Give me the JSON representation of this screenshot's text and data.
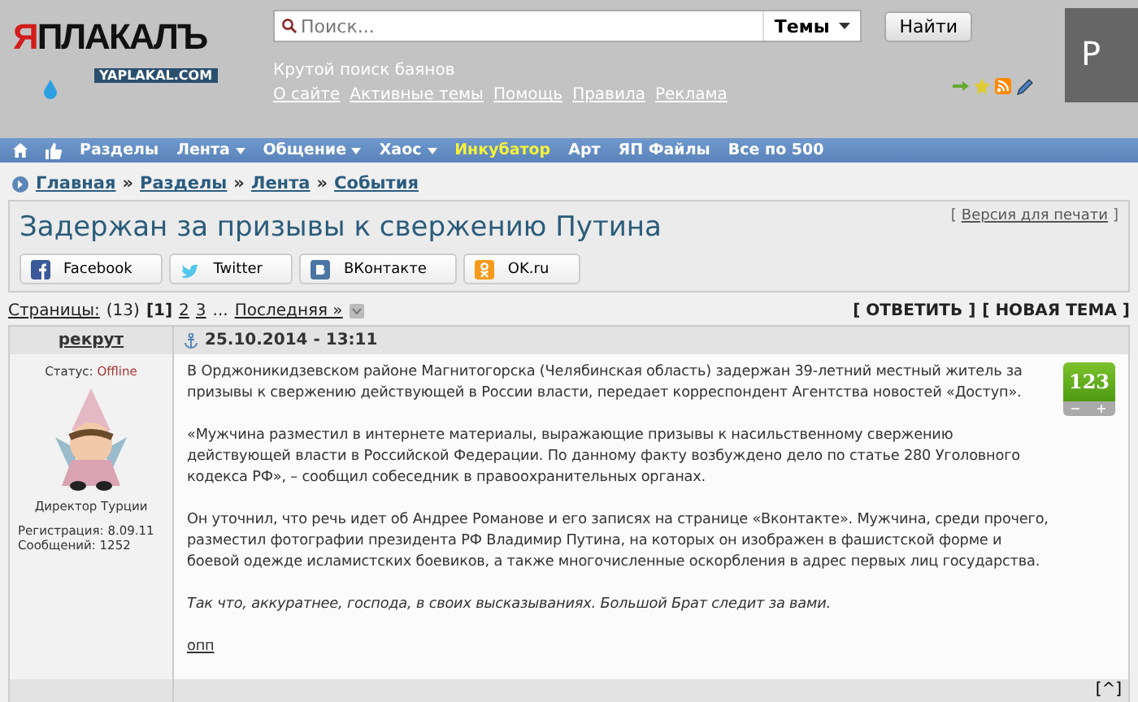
{
  "header": {
    "logo": {
      "title": "ЯПЛАКАЛЪ",
      "subtitle": "YAPLAKAL.COM"
    },
    "search": {
      "placeholder": "Поиск...",
      "scope": "Темы",
      "button": "Найти"
    },
    "tagline": "Крутой поиск баянов",
    "links": [
      "О сайте",
      "Активные темы",
      "Помощь",
      "Правила",
      "Реклама"
    ],
    "ad_text": "Р"
  },
  "nav": {
    "items": [
      {
        "label": "Разделы",
        "dropdown": false,
        "highlighted": false
      },
      {
        "label": "Лента",
        "dropdown": true,
        "highlighted": false
      },
      {
        "label": "Общение",
        "dropdown": true,
        "highlighted": false
      },
      {
        "label": "Хаос",
        "dropdown": true,
        "highlighted": false
      },
      {
        "label": "Инкубатор",
        "dropdown": false,
        "highlighted": true
      },
      {
        "label": "Арт",
        "dropdown": false,
        "highlighted": false
      },
      {
        "label": "ЯП Файлы",
        "dropdown": false,
        "highlighted": false
      },
      {
        "label": "Все по 500",
        "dropdown": false,
        "highlighted": false
      }
    ]
  },
  "breadcrumbs": {
    "separator": "»",
    "items": [
      "Главная",
      "Разделы",
      "Лента",
      "События"
    ]
  },
  "topic": {
    "title": "Задержан за призывы к свержению Путина",
    "print": {
      "open": "[",
      "link": "Версия для печати",
      "close": "]"
    },
    "share": [
      {
        "kind": "facebook",
        "label": "Facebook"
      },
      {
        "kind": "twitter",
        "label": "Twitter"
      },
      {
        "kind": "vk",
        "label": "ВКонтакте"
      },
      {
        "kind": "ok",
        "label": "OK.ru"
      }
    ],
    "pagination": {
      "label": "Страницы:",
      "count": "(13)",
      "pages": [
        {
          "label": "[1]",
          "selected": true
        },
        {
          "label": "2",
          "selected": false
        },
        {
          "label": "3",
          "selected": false
        }
      ],
      "ellipsis": "...",
      "last": "Последняя »"
    },
    "actions": [
      "[ ОТВЕТИТЬ ]",
      "[ НОВАЯ ТЕМА ]"
    ]
  },
  "post": {
    "author": "рекрут",
    "status_label": "Статус:",
    "status": "Offline",
    "rank": "Директор Турции",
    "registration": "Регистрация: 8.09.11",
    "messages": "Сообщений: 1252",
    "date": "25.10.2014 - 13:11",
    "paragraphs": [
      {
        "text": "В Орджоникидзевском районе Магнитогорска (Челябинская область) задержан 39-летний местный житель за призывы к свержению действующей в России власти, передает корреспондент Агентства новостей «Доступ».",
        "italic": false
      },
      {
        "text": "«Мужчина разместил в интернете материалы, выражающие призывы к насильственному свержению действующей власти в Российской Федерации. По данному факту возбуждено дело по статье 280 Уголовного кодекса РФ», – сообщил собеседник в правоохранительных органах.",
        "italic": false
      },
      {
        "text": "Он уточнил, что речь идет об Андрее Романове и его записях на странице «Вконтакте». Мужчина, среди прочего, разместил фотографии президента РФ Владимир Путина, на которых он изображен в фашистской форме и боевой одежде исламистских боевиков, а также многочисленные оскорбления в адрес первых лиц государства.",
        "italic": false
      },
      {
        "text": "Так что, аккуратнее, господа, в своих высказываниях. Большой Брат следит за вами.",
        "italic": true
      }
    ],
    "link": "опп",
    "rating": "123",
    "top": "[^]"
  }
}
